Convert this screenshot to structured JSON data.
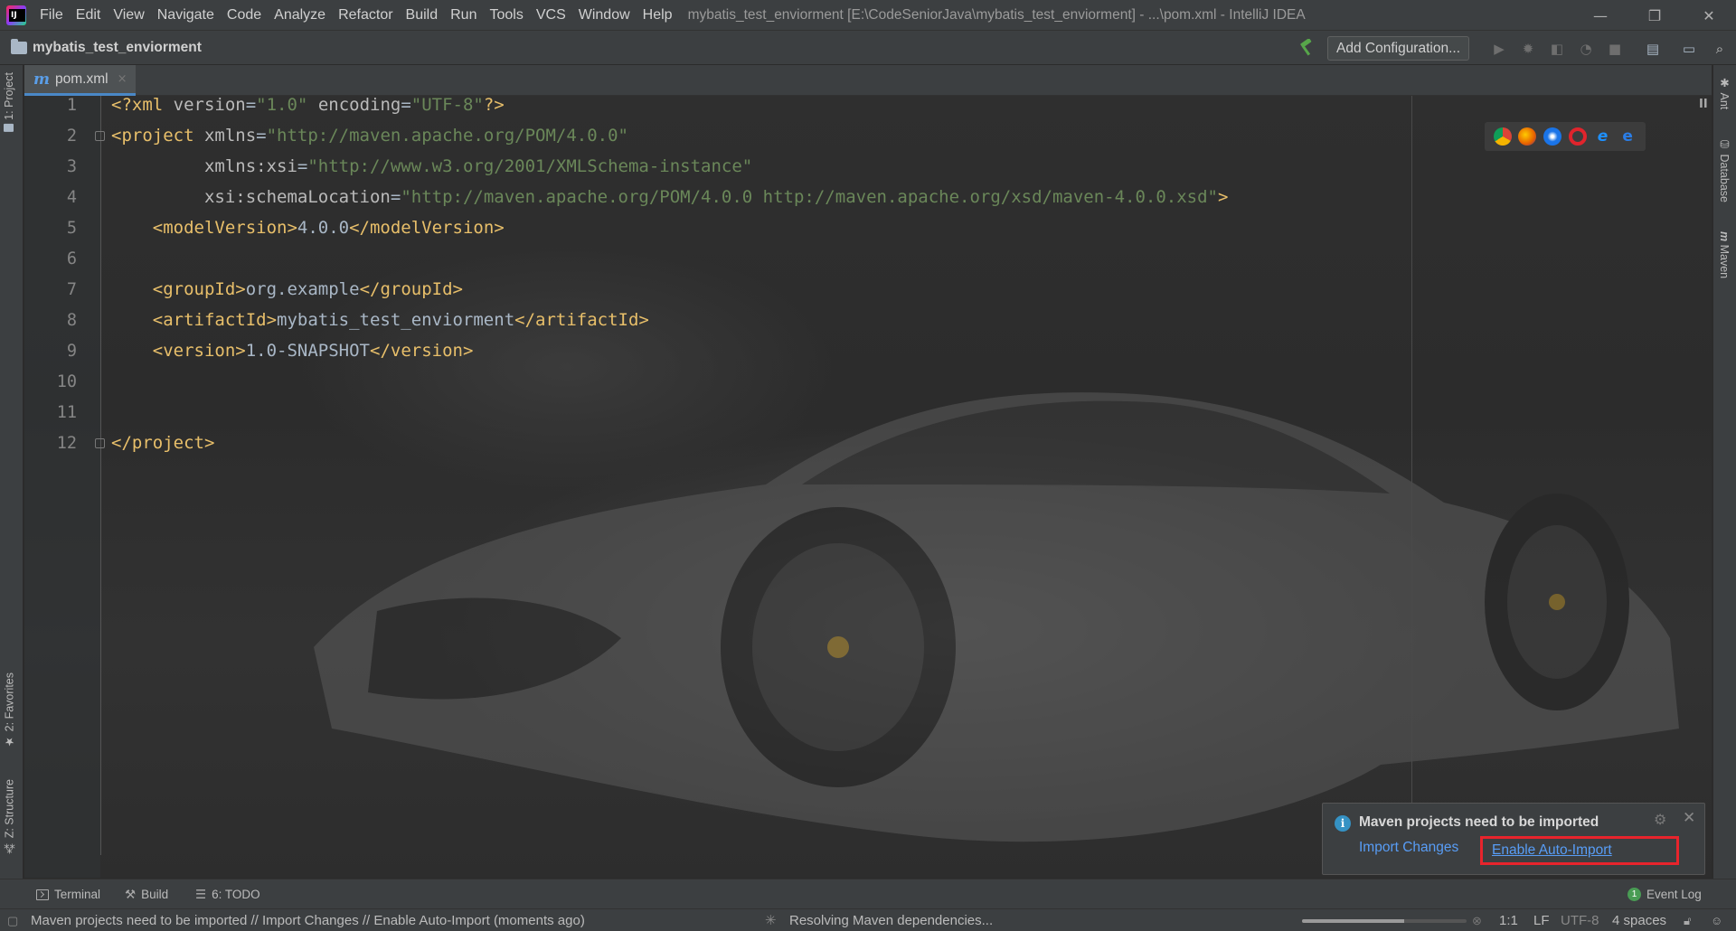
{
  "app": {
    "window_title": "mybatis_test_enviorment [E:\\CodeSeniorJava\\mybatis_test_enviorment] - ...\\pom.xml - IntelliJ IDEA"
  },
  "menu": [
    "File",
    "Edit",
    "View",
    "Navigate",
    "Code",
    "Analyze",
    "Refactor",
    "Build",
    "Run",
    "Tools",
    "VCS",
    "Window",
    "Help"
  ],
  "window_controls": {
    "minimize": "—",
    "restore": "❐",
    "close": "✕"
  },
  "navbar": {
    "project_name": "mybatis_test_enviorment",
    "add_configuration": "Add Configuration..."
  },
  "left_tools": {
    "project": "1: Project",
    "favorites": "2: Favorites",
    "structure": "Z: Structure"
  },
  "right_tools": {
    "ant": "Ant",
    "database": "Database",
    "maven": "Maven"
  },
  "editor_tab": {
    "icon": "m",
    "label": "pom.xml",
    "close": "×"
  },
  "code_lines": [
    {
      "num": "1",
      "tokens": [
        [
          "t-pi",
          "<?xml "
        ],
        [
          "t-attr",
          "version"
        ],
        [
          "t-text",
          "="
        ],
        [
          "t-val",
          "\"1.0\""
        ],
        [
          "t-attr",
          " encoding"
        ],
        [
          "t-text",
          "="
        ],
        [
          "t-val",
          "\"UTF-8\""
        ],
        [
          "t-pi",
          "?>"
        ]
      ]
    },
    {
      "num": "2",
      "tokens": [
        [
          "t-tag",
          "<project "
        ],
        [
          "t-attr",
          "xmlns"
        ],
        [
          "t-text",
          "="
        ],
        [
          "t-val",
          "\"http://maven.apache.org/POM/4.0.0\""
        ]
      ]
    },
    {
      "num": "3",
      "tokens": [
        [
          "t-attr",
          "         xmlns:xsi"
        ],
        [
          "t-text",
          "="
        ],
        [
          "t-val",
          "\"http://www.w3.org/2001/XMLSchema-instance\""
        ]
      ]
    },
    {
      "num": "4",
      "tokens": [
        [
          "t-attr",
          "         xsi:schemaLocation"
        ],
        [
          "t-text",
          "="
        ],
        [
          "t-val",
          "\"http://maven.apache.org/POM/4.0.0 http://maven.apache.org/xsd/maven-4.0.0.xsd\""
        ],
        [
          "t-tag",
          ">"
        ]
      ]
    },
    {
      "num": "5",
      "tokens": [
        [
          "t-tag",
          "    <modelVersion>"
        ],
        [
          "t-text",
          "4.0.0"
        ],
        [
          "t-tag",
          "</modelVersion>"
        ]
      ]
    },
    {
      "num": "6",
      "tokens": []
    },
    {
      "num": "7",
      "tokens": [
        [
          "t-tag",
          "    <groupId>"
        ],
        [
          "t-text",
          "org.example"
        ],
        [
          "t-tag",
          "</groupId>"
        ]
      ]
    },
    {
      "num": "8",
      "tokens": [
        [
          "t-tag",
          "    <artifactId>"
        ],
        [
          "t-text",
          "mybatis_test_enviorment"
        ],
        [
          "t-tag",
          "</artifactId>"
        ]
      ]
    },
    {
      "num": "9",
      "tokens": [
        [
          "t-tag",
          "    <version>"
        ],
        [
          "t-text",
          "1.0-SNAPSHOT"
        ],
        [
          "t-tag",
          "</version>"
        ]
      ]
    },
    {
      "num": "10",
      "tokens": []
    },
    {
      "num": "11",
      "tokens": []
    },
    {
      "num": "12",
      "tokens": [
        [
          "t-tag",
          "</project>"
        ]
      ]
    }
  ],
  "notification": {
    "title": "Maven projects need to be imported",
    "import_changes": "Import Changes",
    "enable_auto_import": "Enable Auto-Import"
  },
  "bottom_tools": {
    "terminal": "Terminal",
    "build": "Build",
    "todo": "6: TODO",
    "event_log": "Event Log",
    "event_count": "1"
  },
  "status": {
    "message": "Maven projects need to be imported // Import Changes // Enable Auto-Import (moments ago)",
    "background_task": "Resolving Maven dependencies...",
    "progress": 0.62,
    "caret": "1:1",
    "line_separator": "LF",
    "encoding": "UTF-8",
    "indent": "4 spaces"
  },
  "colors": {
    "accent": "#4a88c7",
    "link": "#589df6",
    "highlight_box": "#e8242c",
    "xml_tag": "#e8bf6a",
    "xml_value": "#6a8759"
  }
}
